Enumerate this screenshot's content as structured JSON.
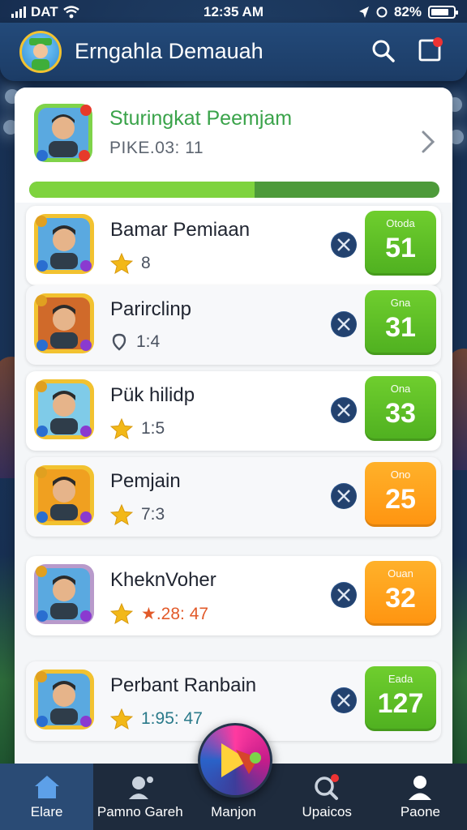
{
  "status_bar": {
    "carrier": "DAT",
    "time": "12:35 AM",
    "battery": "82%",
    "battery_level": 0.82
  },
  "header": {
    "title": "Erngahla Demauah",
    "avatar_icon": "player-avatar-icon",
    "search_icon": "search-icon",
    "notification_icon": "notification-icon"
  },
  "top_card": {
    "name": "Sturingkat Peemjam",
    "subtitle": "PIKE.03: 11",
    "progress": 0.55,
    "chevron_icon": "chevron-right-icon"
  },
  "players": [
    {
      "name": "Bamar Pemiaan",
      "meta_icon": "star-icon",
      "meta": "8",
      "score_label": "Otoda",
      "score": "51",
      "score_color": "#58b82a"
    },
    {
      "name": "Parirclinp",
      "meta_icon": "location-pin-icon",
      "meta": "1:4",
      "score_label": "Gna",
      "score": "31",
      "score_color": "#58b82a"
    },
    {
      "name": "Pük hilidp",
      "meta_icon": "star-icon",
      "meta": "1:5",
      "score_label": "Ona",
      "score": "33",
      "score_color": "#58b82a"
    },
    {
      "name": "Pemjain",
      "meta_icon": "star-icon",
      "meta": "7:3",
      "score_label": "Ono",
      "score": "25",
      "score_color": "#ffa21a"
    },
    {
      "name": "KheknVoher",
      "meta_icon": "star-icon",
      "meta": "★.28: 47",
      "score_label": "Ouan",
      "score": "32",
      "score_color": "#ffa21a"
    },
    {
      "name": "Perbant Ranbain",
      "meta_icon": "star-icon",
      "meta": "1:95: 47",
      "score_label": "Eada",
      "score": "127",
      "score_color": "#58b82a"
    }
  ],
  "nav": [
    {
      "label": "Elare",
      "icon": "home-icon",
      "active": true
    },
    {
      "label": "Pamno Gareh",
      "icon": "players-icon",
      "active": false
    },
    {
      "label": "Manjon",
      "icon": "play-icon",
      "active": false
    },
    {
      "label": "Upaicos",
      "icon": "search-notify-icon",
      "active": false
    },
    {
      "label": "Paone",
      "icon": "profile-icon",
      "active": false
    }
  ],
  "colors": {
    "accent_green": "#58b82a",
    "accent_orange": "#ffa21a",
    "header_blue": "#1c3c66"
  }
}
